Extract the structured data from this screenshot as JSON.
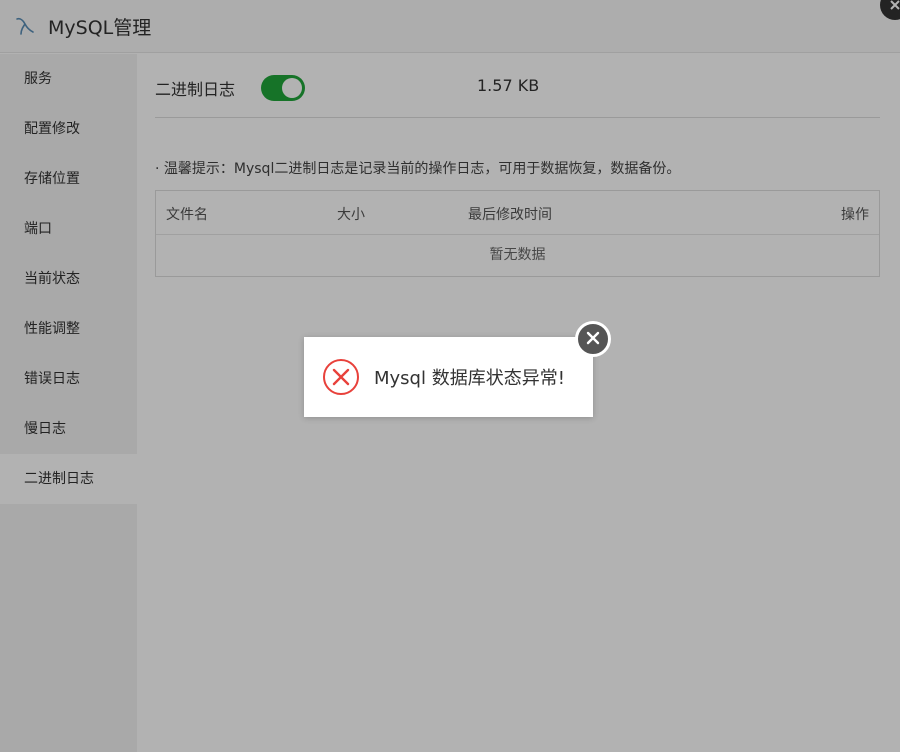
{
  "window": {
    "title": "MySQL管理",
    "logo_icon": "mysql-dolphin-icon",
    "close_icon": "close-icon"
  },
  "sidebar": {
    "items": [
      {
        "label": "服务",
        "active": false
      },
      {
        "label": "配置修改",
        "active": false
      },
      {
        "label": "存储位置",
        "active": false
      },
      {
        "label": "端口",
        "active": false
      },
      {
        "label": "当前状态",
        "active": false
      },
      {
        "label": "性能调整",
        "active": false
      },
      {
        "label": "错误日志",
        "active": false
      },
      {
        "label": "慢日志",
        "active": false
      },
      {
        "label": "二进制日志",
        "active": true
      }
    ]
  },
  "main": {
    "toggle_label": "二进制日志",
    "toggle_on": true,
    "size_value": "1.57 KB",
    "tip": "· 温馨提示：Mysql二进制日志是记录当前的操作日志，可用于数据恢复，数据备份。",
    "table": {
      "columns": [
        "文件名",
        "大小",
        "最后修改时间",
        "操作"
      ],
      "empty_text": "暂无数据"
    }
  },
  "dialog": {
    "message": "Mysql 数据库状态异常!",
    "icon": "error-x-icon",
    "close_icon": "close-icon"
  },
  "colors": {
    "accent": "#20a53a",
    "error": "#e8413b"
  }
}
